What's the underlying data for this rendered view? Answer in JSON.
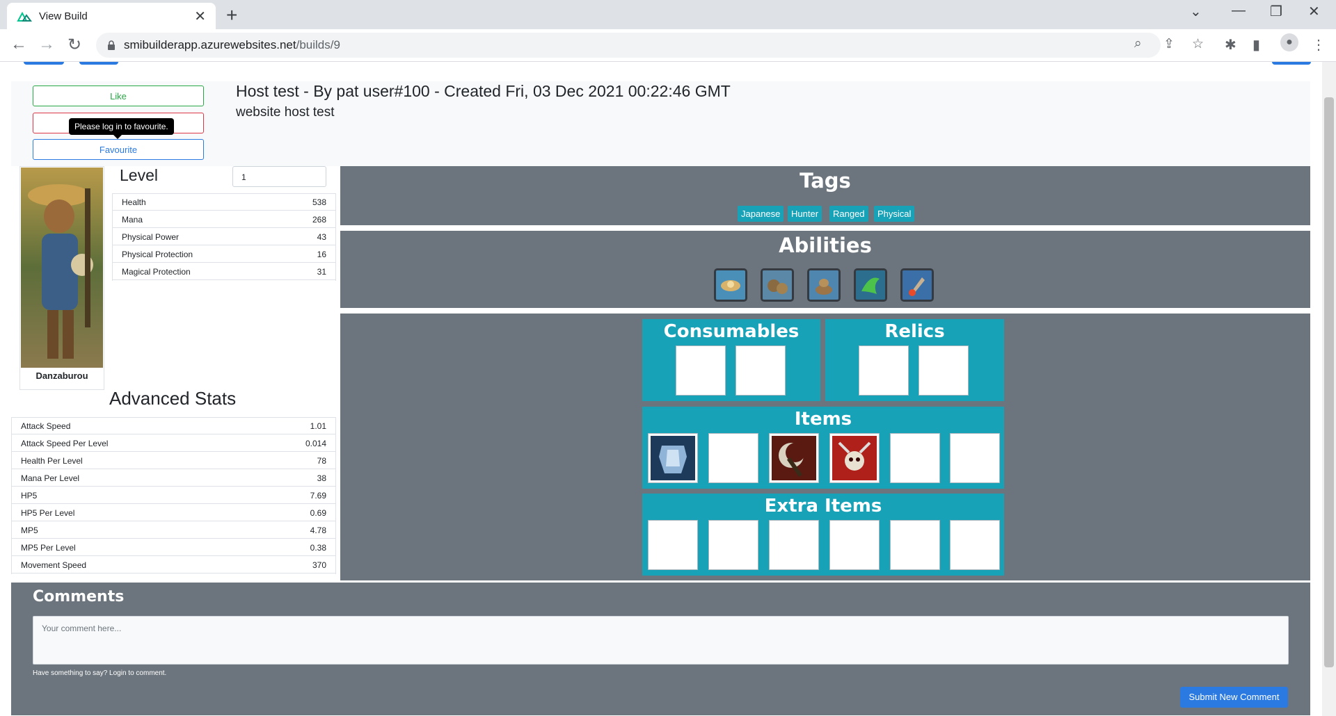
{
  "browser": {
    "tab_title": "View Build",
    "url_host": "smibuilderapp.azurewebsites.net",
    "url_path": "/builds/9"
  },
  "build": {
    "like_label": "Like",
    "dislike_label": "",
    "favourite_label": "Favourite",
    "tooltip": "Please log in to favourite.",
    "title": "Host test - By pat user#100 - Created Fri, 03 Dec 2021 00:22:46 GMT",
    "description": "website host test"
  },
  "god": {
    "name": "Danzaburou",
    "level_label": "Level",
    "level_value": "1",
    "stats": [
      {
        "label": "Health",
        "value": "538"
      },
      {
        "label": "Mana",
        "value": "268"
      },
      {
        "label": "Physical Power",
        "value": "43"
      },
      {
        "label": "Physical Protection",
        "value": "16"
      },
      {
        "label": "Magical Protection",
        "value": "31"
      }
    ]
  },
  "advanced": {
    "title": "Advanced Stats",
    "stats": [
      {
        "label": "Attack Speed",
        "value": "1.01"
      },
      {
        "label": "Attack Speed Per Level",
        "value": "0.014"
      },
      {
        "label": "Health Per Level",
        "value": "78"
      },
      {
        "label": "Mana Per Level",
        "value": "38"
      },
      {
        "label": "HP5",
        "value": "7.69"
      },
      {
        "label": "HP5 Per Level",
        "value": "0.69"
      },
      {
        "label": "MP5",
        "value": "4.78"
      },
      {
        "label": "MP5 Per Level",
        "value": "0.38"
      },
      {
        "label": "Movement Speed",
        "value": "370"
      }
    ]
  },
  "tags": {
    "title": "Tags",
    "items": [
      "Japanese",
      "Hunter",
      "Ranged",
      "Physical"
    ]
  },
  "abilities": {
    "title": "Abilities",
    "icons": [
      "passive-ability-icon",
      "ability-1-icon",
      "ability-2-icon",
      "ability-3-icon",
      "ultimate-ability-icon"
    ]
  },
  "equipment": {
    "consumables_title": "Consumables",
    "relics_title": "Relics",
    "items_title": "Items",
    "extra_items_title": "Extra Items",
    "items": [
      "armor-item-icon",
      "",
      "axe-item-icon",
      "spiked-skull-item-icon",
      "",
      ""
    ]
  },
  "comments": {
    "title": "Comments",
    "placeholder": "Your comment here...",
    "help": "Have something to say? Login to comment.",
    "submit_label": "Submit New Comment"
  },
  "colors": {
    "panel": "#6c757d",
    "teal": "#17a2b8",
    "primary": "#2a7ae2",
    "success": "#28a745",
    "danger": "#dc3545"
  }
}
